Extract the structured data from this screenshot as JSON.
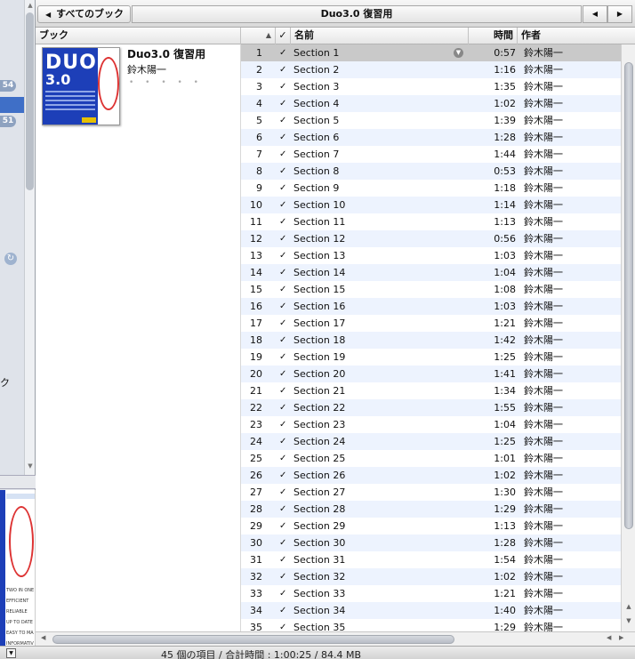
{
  "sidebar": {
    "badges": [
      "54",
      "51"
    ],
    "partial_label": "ク"
  },
  "mini_cover": {
    "lines": [
      "TWO IN ONE",
      "EFFICIENT",
      "RELIABLE",
      "UP TO DATE",
      "EASY TO MA",
      "INFORMATIV"
    ]
  },
  "topbar": {
    "back_label": "すべてのブック",
    "title": "Duo3.0 復習用"
  },
  "columns": {
    "book": "ブック",
    "check": "✓",
    "name": "名前",
    "time": "時間",
    "artist": "作者"
  },
  "album": {
    "title": "Duo3.0 復習用",
    "artist": "鈴木陽一",
    "cover_text": "DUO",
    "cover_version": "3.0",
    "rating_dots": "• • • • •"
  },
  "tracks": [
    {
      "num": "1",
      "name": "Section 1",
      "time": "0:57",
      "artist": "鈴木陽一"
    },
    {
      "num": "2",
      "name": "Section 2",
      "time": "1:16",
      "artist": "鈴木陽一"
    },
    {
      "num": "3",
      "name": "Section 3",
      "time": "1:35",
      "artist": "鈴木陽一"
    },
    {
      "num": "4",
      "name": "Section 4",
      "time": "1:02",
      "artist": "鈴木陽一"
    },
    {
      "num": "5",
      "name": "Section 5",
      "time": "1:39",
      "artist": "鈴木陽一"
    },
    {
      "num": "6",
      "name": "Section 6",
      "time": "1:28",
      "artist": "鈴木陽一"
    },
    {
      "num": "7",
      "name": "Section 7",
      "time": "1:44",
      "artist": "鈴木陽一"
    },
    {
      "num": "8",
      "name": "Section 8",
      "time": "0:53",
      "artist": "鈴木陽一"
    },
    {
      "num": "9",
      "name": "Section 9",
      "time": "1:18",
      "artist": "鈴木陽一"
    },
    {
      "num": "10",
      "name": "Section 10",
      "time": "1:14",
      "artist": "鈴木陽一"
    },
    {
      "num": "11",
      "name": "Section 11",
      "time": "1:13",
      "artist": "鈴木陽一"
    },
    {
      "num": "12",
      "name": "Section 12",
      "time": "0:56",
      "artist": "鈴木陽一"
    },
    {
      "num": "13",
      "name": "Section 13",
      "time": "1:03",
      "artist": "鈴木陽一"
    },
    {
      "num": "14",
      "name": "Section 14",
      "time": "1:04",
      "artist": "鈴木陽一"
    },
    {
      "num": "15",
      "name": "Section 15",
      "time": "1:08",
      "artist": "鈴木陽一"
    },
    {
      "num": "16",
      "name": "Section 16",
      "time": "1:03",
      "artist": "鈴木陽一"
    },
    {
      "num": "17",
      "name": "Section 17",
      "time": "1:21",
      "artist": "鈴木陽一"
    },
    {
      "num": "18",
      "name": "Section 18",
      "time": "1:42",
      "artist": "鈴木陽一"
    },
    {
      "num": "19",
      "name": "Section 19",
      "time": "1:25",
      "artist": "鈴木陽一"
    },
    {
      "num": "20",
      "name": "Section 20",
      "time": "1:41",
      "artist": "鈴木陽一"
    },
    {
      "num": "21",
      "name": "Section 21",
      "time": "1:34",
      "artist": "鈴木陽一"
    },
    {
      "num": "22",
      "name": "Section 22",
      "time": "1:55",
      "artist": "鈴木陽一"
    },
    {
      "num": "23",
      "name": "Section 23",
      "time": "1:04",
      "artist": "鈴木陽一"
    },
    {
      "num": "24",
      "name": "Section 24",
      "time": "1:25",
      "artist": "鈴木陽一"
    },
    {
      "num": "25",
      "name": "Section 25",
      "time": "1:01",
      "artist": "鈴木陽一"
    },
    {
      "num": "26",
      "name": "Section 26",
      "time": "1:02",
      "artist": "鈴木陽一"
    },
    {
      "num": "27",
      "name": "Section 27",
      "time": "1:30",
      "artist": "鈴木陽一"
    },
    {
      "num": "28",
      "name": "Section 28",
      "time": "1:29",
      "artist": "鈴木陽一"
    },
    {
      "num": "29",
      "name": "Section 29",
      "time": "1:13",
      "artist": "鈴木陽一"
    },
    {
      "num": "30",
      "name": "Section 30",
      "time": "1:28",
      "artist": "鈴木陽一"
    },
    {
      "num": "31",
      "name": "Section 31",
      "time": "1:54",
      "artist": "鈴木陽一"
    },
    {
      "num": "32",
      "name": "Section 32",
      "time": "1:02",
      "artist": "鈴木陽一"
    },
    {
      "num": "33",
      "name": "Section 33",
      "time": "1:21",
      "artist": "鈴木陽一"
    },
    {
      "num": "34",
      "name": "Section 34",
      "time": "1:40",
      "artist": "鈴木陽一"
    },
    {
      "num": "35",
      "name": "Section 35",
      "time": "1:29",
      "artist": "鈴木陽一"
    }
  ],
  "selected_track_index": 0,
  "status": {
    "text": "45 個の項目 / 合計時間 : 1:00:25 / 84.4 MB"
  },
  "icons": {
    "back": "triangle-left-icon",
    "prev": "triangle-left-icon",
    "next": "triangle-right-icon",
    "sort": "sort-up-icon",
    "check": "checkmark-icon",
    "row_arrow": "circle-arrow-icon",
    "sync": "sync-icon",
    "status_menu": "triangle-down-icon"
  },
  "colors": {
    "selection": "#c9c9c9",
    "stripe": "#edf3fe",
    "sidebar_badge": "#8ea2c0",
    "sidebar_selection": "#3f6fc7"
  }
}
